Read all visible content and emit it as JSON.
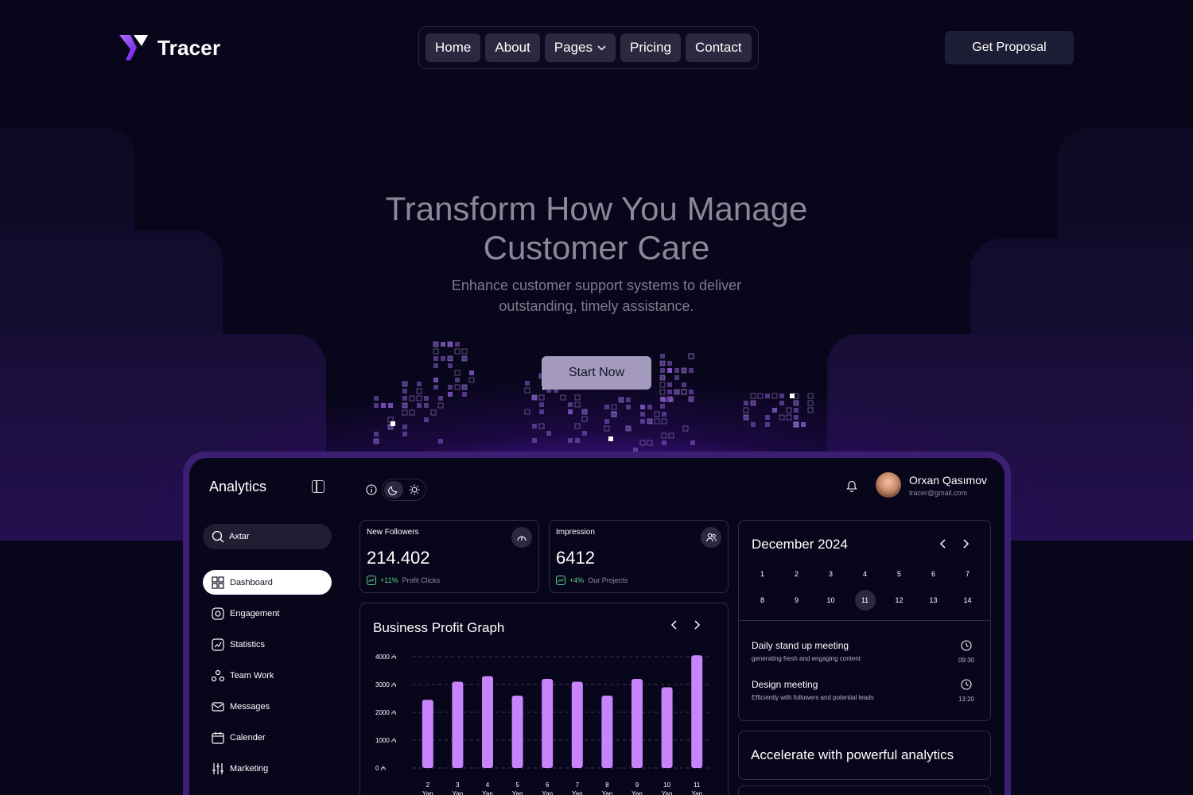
{
  "brand": {
    "name": "Tracer",
    "accent": "#8b3cf7"
  },
  "nav": {
    "items": [
      {
        "label": "Home"
      },
      {
        "label": "About"
      },
      {
        "label": "Pages",
        "has_dropdown": true
      },
      {
        "label": "Pricing"
      },
      {
        "label": "Contact"
      }
    ],
    "cta": "Get Proposal"
  },
  "hero": {
    "title_line1": "Transform How You Manage",
    "title_line2": "Customer Care",
    "subtitle_line1": "Enhance customer support systems to deliver",
    "subtitle_line2": "outstanding, timely assistance.",
    "button": "Start Now"
  },
  "dashboard": {
    "sidebar": {
      "title": "Analytics",
      "search_value": "Axtar",
      "items": [
        {
          "label": "Dashboard",
          "icon": "grid-icon",
          "active": true
        },
        {
          "label": "Engagement",
          "icon": "engagement-icon"
        },
        {
          "label": "Statistics",
          "icon": "statistics-icon"
        },
        {
          "label": "Team Work",
          "icon": "team-icon"
        },
        {
          "label": "Messages",
          "icon": "mail-icon"
        },
        {
          "label": "Calender",
          "icon": "calendar-icon"
        },
        {
          "label": "Marketing",
          "icon": "sliders-icon"
        }
      ]
    },
    "user": {
      "name": "Orxan Qasımov",
      "email": "tracer@gmail.com"
    },
    "stats": [
      {
        "label": "New Followers",
        "value": "214.402",
        "change": "+11%",
        "note": "Profit Clicks",
        "icon": "gauge-icon"
      },
      {
        "label": "Impression",
        "value": "6412",
        "change": "+4%",
        "note": "Our Projects",
        "icon": "users-icon"
      }
    ],
    "graph": {
      "title": "Business Profit Graph"
    },
    "calendar": {
      "title": "December 2024",
      "week1": [
        "1",
        "2",
        "3",
        "4",
        "5",
        "6",
        "7"
      ],
      "week2": [
        "8",
        "9",
        "10",
        "11",
        "12",
        "13",
        "14"
      ],
      "selected": "11",
      "events": [
        {
          "title": "Daily stand up meeting",
          "desc": "generating fresh and engaging content",
          "time": "09:30"
        },
        {
          "title": "Design meeting",
          "desc": "Efficiently with followers and potential leads",
          "time": "13:20"
        }
      ]
    },
    "promo": "Accelerate with powerful analytics"
  },
  "chart_data": {
    "type": "bar",
    "title": "Business Profit Graph",
    "categories": [
      "2 Yan",
      "3 Yan",
      "4 Yan",
      "5 Yan",
      "6 Yan",
      "7 Yan",
      "8 Yan",
      "9 Yan",
      "10 Yan",
      "11 Yan"
    ],
    "category_labels": [
      {
        "day": "2",
        "unit": "Yan"
      },
      {
        "day": "3",
        "unit": "Yan"
      },
      {
        "day": "4",
        "unit": "Yan"
      },
      {
        "day": "5",
        "unit": "Yan"
      },
      {
        "day": "6",
        "unit": "Yan"
      },
      {
        "day": "7",
        "unit": "Yan"
      },
      {
        "day": "8",
        "unit": "Yan"
      },
      {
        "day": "9",
        "unit": "Yan"
      },
      {
        "day": "10",
        "unit": "Yan"
      },
      {
        "day": "11",
        "unit": "Yan"
      }
    ],
    "values": [
      2450,
      3100,
      3300,
      2600,
      3200,
      3100,
      2600,
      3200,
      2900,
      4050
    ],
    "ylim": [
      0,
      4000
    ],
    "yticks": [
      {
        "value": 0,
        "label": "0 ₼"
      },
      {
        "value": 1000,
        "label": "1000 ₼"
      },
      {
        "value": 2000,
        "label": "2000 ₼"
      },
      {
        "value": 3000,
        "label": "3000 ₼"
      },
      {
        "value": 4000,
        "label": "4000 ₼"
      }
    ],
    "grid": true,
    "bar_color": "#c784fb"
  }
}
